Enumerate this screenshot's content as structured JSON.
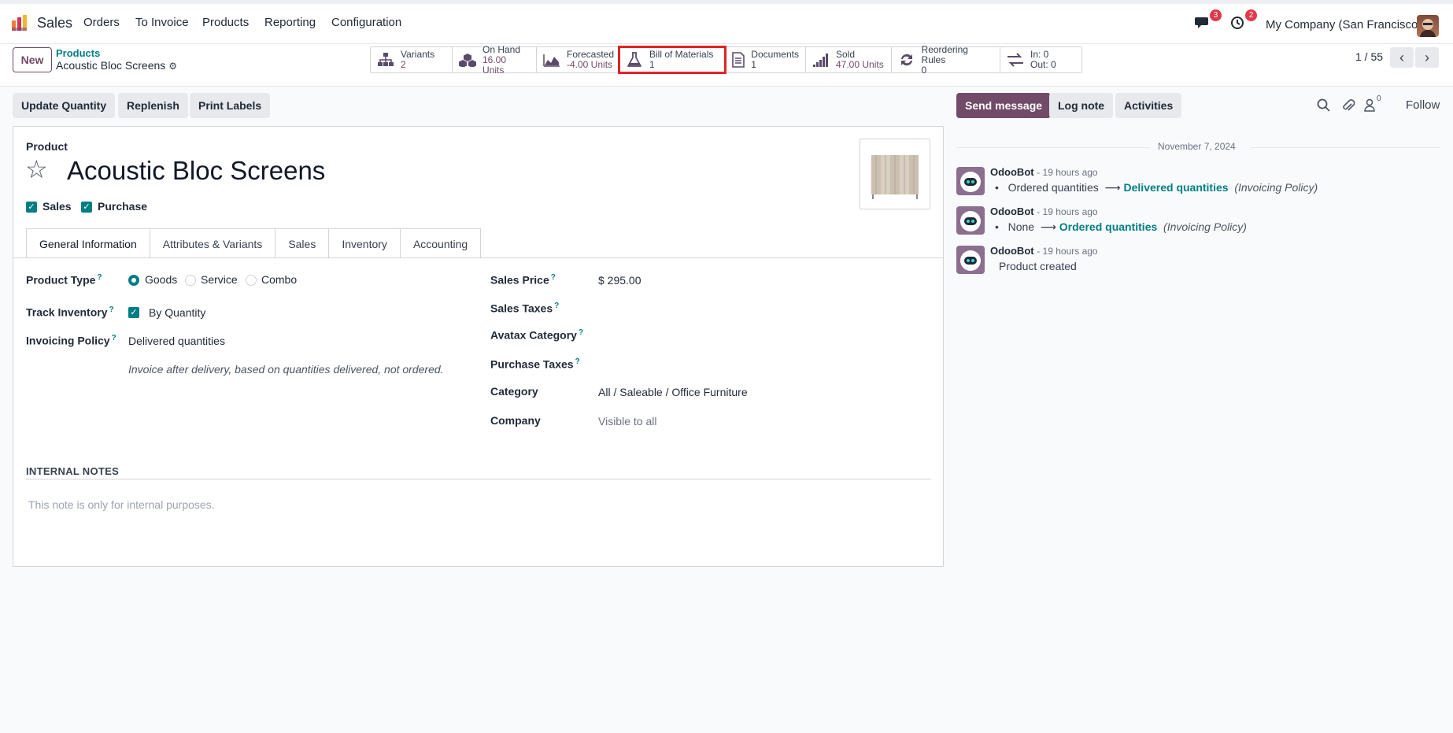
{
  "app": {
    "name": "Sales"
  },
  "menu": [
    {
      "label": "Orders"
    },
    {
      "label": "To Invoice"
    },
    {
      "label": "Products"
    },
    {
      "label": "Reporting"
    },
    {
      "label": "Configuration"
    }
  ],
  "nav_right": {
    "messages_count": "3",
    "activities_count": "2",
    "company": "My Company (San Francisco)"
  },
  "control": {
    "new_label": "New",
    "breadcrumb_parent": "Products",
    "breadcrumb_current": "Acoustic Bloc Screens",
    "pager": "1 / 55"
  },
  "stat_buttons": [
    {
      "label": "Variants",
      "value": "2",
      "icon": "sitemap-icon"
    },
    {
      "label": "On Hand",
      "value": "16.00 Units",
      "icon": "cubes-icon"
    },
    {
      "label": "Forecasted",
      "value": "-4.00 Units",
      "icon": "area-chart-icon"
    },
    {
      "label": "Bill of Materials",
      "value": "1",
      "icon": "flask-icon"
    },
    {
      "label": "Documents",
      "value": "1",
      "icon": "file-text-icon"
    },
    {
      "label": "Sold",
      "value": "47.00 Units",
      "icon": "signal-icon"
    },
    {
      "label": "Reordering Rules",
      "value": "0",
      "icon": "refresh-icon"
    },
    {
      "label": "In: 0",
      "value": "Out: 0",
      "icon": "exchange-icon"
    }
  ],
  "actions": {
    "update_quantity": "Update Quantity",
    "replenish": "Replenish",
    "print_labels": "Print Labels"
  },
  "chatter_actions": {
    "send_message": "Send message",
    "log_note": "Log note",
    "activities": "Activities",
    "followers_count": "0",
    "follow": "Follow"
  },
  "product": {
    "section_label": "Product",
    "name": "Acoustic Bloc Screens",
    "can_be_sold_label": "Sales",
    "can_be_purchased_label": "Purchase"
  },
  "tabs": [
    {
      "label": "General Information"
    },
    {
      "label": "Attributes & Variants"
    },
    {
      "label": "Sales"
    },
    {
      "label": "Inventory"
    },
    {
      "label": "Accounting"
    }
  ],
  "general": {
    "product_type_label": "Product Type",
    "product_type_options": [
      "Goods",
      "Service",
      "Combo"
    ],
    "product_type_selected": "Goods",
    "track_inventory_label": "Track Inventory",
    "track_inventory_value": "By Quantity",
    "invoicing_policy_label": "Invoicing Policy",
    "invoicing_policy_value": "Delivered quantities",
    "invoicing_policy_note": "Invoice after delivery, based on quantities delivered, not ordered.",
    "sales_price_label": "Sales Price",
    "sales_price_value": "$ 295.00",
    "sales_taxes_label": "Sales Taxes",
    "avatax_label": "Avatax Category",
    "purchase_taxes_label": "Purchase Taxes",
    "category_label": "Category",
    "category_value": "All / Saleable / Office Furniture",
    "company_label": "Company",
    "company_value": "Visible to all",
    "internal_notes_label": "INTERNAL NOTES",
    "internal_notes_placeholder": "This note is only for internal purposes."
  },
  "chatter": {
    "date": "November 7, 2024",
    "messages": [
      {
        "author": "OdooBot",
        "time": "- 19 hours ago",
        "from": "Ordered quantities",
        "to": "Delivered quantities",
        "field": "(Invoicing Policy)"
      },
      {
        "author": "OdooBot",
        "time": "- 19 hours ago",
        "from": "None",
        "to": "Ordered quantities",
        "field": "(Invoicing Policy)"
      },
      {
        "author": "OdooBot",
        "time": "- 19 hours ago",
        "body": "Product created"
      }
    ]
  },
  "colors": {
    "brand": "#714b67",
    "accent": "#017e84",
    "highlight": "#e02424",
    "badge": "#e0384a"
  }
}
